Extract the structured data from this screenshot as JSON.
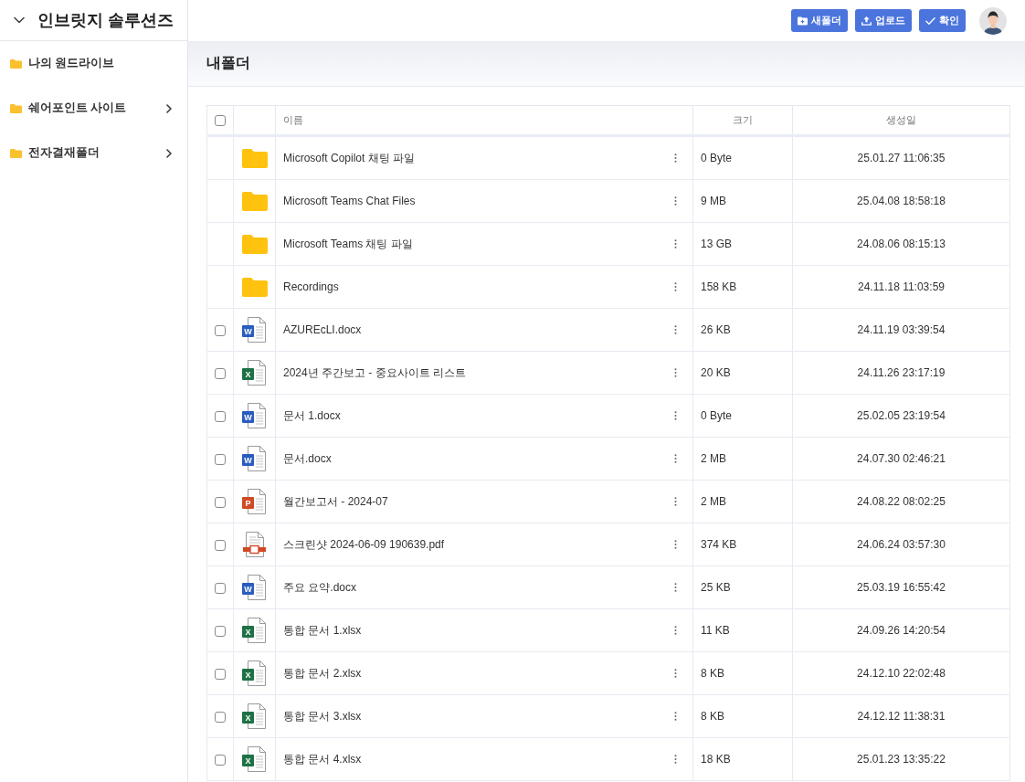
{
  "sidebar": {
    "title": "인브릿지 솔루션즈",
    "expanded": true,
    "items": [
      {
        "label": "나의 원드라이브",
        "expandable": false
      },
      {
        "label": "쉐어포인트 사이트",
        "expandable": true
      },
      {
        "label": "전자결재폴더",
        "expandable": true
      }
    ]
  },
  "toolbar": {
    "buttons": [
      {
        "kind": "new_folder",
        "label": "새폴더"
      },
      {
        "kind": "upload",
        "label": "업로드"
      },
      {
        "kind": "confirm",
        "label": "확인"
      }
    ]
  },
  "page": {
    "title": "내폴더"
  },
  "table": {
    "select_all": {
      "checked": false
    },
    "columns": [
      {
        "kind": "name",
        "label": "이름"
      },
      {
        "kind": "size",
        "label": "크기"
      },
      {
        "kind": "created",
        "label": "생성일"
      }
    ],
    "rows": [
      {
        "kind": "folder",
        "name": "Microsoft Copilot 채팅 파일",
        "size": "0 Byte",
        "created": "25.01.27 11:06:35"
      },
      {
        "kind": "folder",
        "name": "Microsoft Teams Chat Files",
        "size": "9 MB",
        "created": "25.04.08 18:58:18"
      },
      {
        "kind": "folder",
        "name": "Microsoft Teams 채팅 파일",
        "size": "13 GB",
        "created": "24.08.06 08:15:13"
      },
      {
        "kind": "folder",
        "name": "Recordings",
        "size": "158 KB",
        "created": "24.11.18 11:03:59"
      },
      {
        "kind": "word",
        "badge": "W",
        "checked": false,
        "name": "AZUREcLI.docx",
        "size": "26 KB",
        "created": "24.11.19 03:39:54"
      },
      {
        "kind": "excel",
        "badge": "X",
        "checked": false,
        "name": "2024년 주간보고 - 중요사이트 리스트",
        "size": "20 KB",
        "created": "24.11.26 23:17:19"
      },
      {
        "kind": "word",
        "badge": "W",
        "checked": false,
        "name": "문서 1.docx",
        "size": "0 Byte",
        "created": "25.02.05 23:19:54"
      },
      {
        "kind": "word",
        "badge": "W",
        "checked": false,
        "name": "문서.docx",
        "size": "2 MB",
        "created": "24.07.30 02:46:21"
      },
      {
        "kind": "powerpoint",
        "badge": "P",
        "checked": false,
        "name": "월간보고서 - 2024-07",
        "size": "2 MB",
        "created": "24.08.22 08:02:25"
      },
      {
        "kind": "pdf",
        "checked": false,
        "name": "스크린샷 2024-06-09 190639.pdf",
        "size": "374 KB",
        "created": "24.06.24 03:57:30"
      },
      {
        "kind": "word",
        "badge": "W",
        "checked": false,
        "name": "주요 요약.docx",
        "size": "25 KB",
        "created": "25.03.19 16:55:42"
      },
      {
        "kind": "excel",
        "badge": "X",
        "checked": false,
        "name": "통합 문서 1.xlsx",
        "size": "11 KB",
        "created": "24.09.26 14:20:54"
      },
      {
        "kind": "excel",
        "badge": "X",
        "checked": false,
        "name": "통합 문서 2.xlsx",
        "size": "8 KB",
        "created": "24.12.10 22:02:48"
      },
      {
        "kind": "excel",
        "badge": "X",
        "checked": false,
        "name": "통합 문서 3.xlsx",
        "size": "8 KB",
        "created": "24.12.12 11:38:31"
      },
      {
        "kind": "excel",
        "badge": "X",
        "checked": false,
        "name": "통합 문서 4.xlsx",
        "size": "18 KB",
        "created": "25.01.23 13:35:22"
      }
    ]
  }
}
